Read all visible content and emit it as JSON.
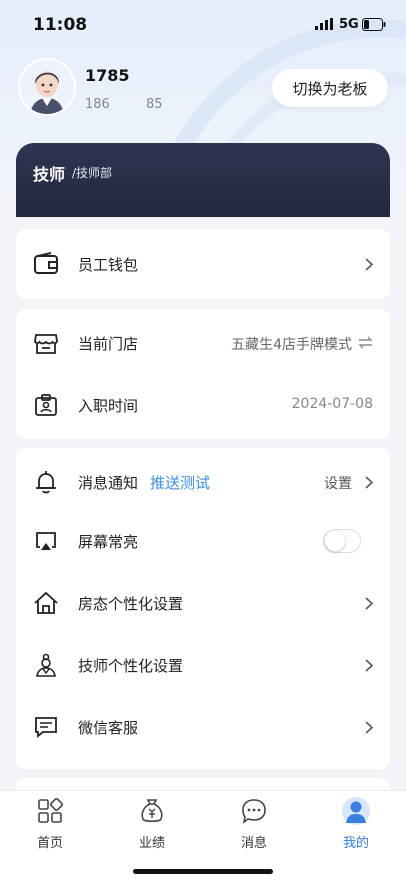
{
  "status_bar": {
    "time": "11:08",
    "network": "5G"
  },
  "profile": {
    "name": "1785",
    "stat_a": "186",
    "stat_b": "85",
    "switch_button": "切换为老板"
  },
  "role": {
    "title": "技师",
    "department": "/技师部"
  },
  "wallet": {
    "label": "员工钱包"
  },
  "store": {
    "current_store_label": "当前门店",
    "current_store_value": "五藏生4店手牌模式",
    "join_date_label": "入职时间",
    "join_date_value": "2024-07-08"
  },
  "settings": {
    "notification_label": "消息通知",
    "push_test_link": "推送测试",
    "notification_value": "设置",
    "screen_on_label": "屏幕常亮",
    "screen_on_enabled": false,
    "room_settings_label": "房态个性化设置",
    "tech_settings_label": "技师个性化设置",
    "wechat_service_label": "微信客服"
  },
  "tabbar": {
    "items": [
      {
        "label": "首页",
        "icon": "grid-icon"
      },
      {
        "label": "业绩",
        "icon": "money-bag-icon"
      },
      {
        "label": "消息",
        "icon": "chat-icon"
      },
      {
        "label": "我的",
        "icon": "person-icon",
        "active": true
      }
    ]
  },
  "colors": {
    "accent": "#3a7fe0",
    "link": "#3a8ee6",
    "role_card": "#2a2f4a"
  }
}
